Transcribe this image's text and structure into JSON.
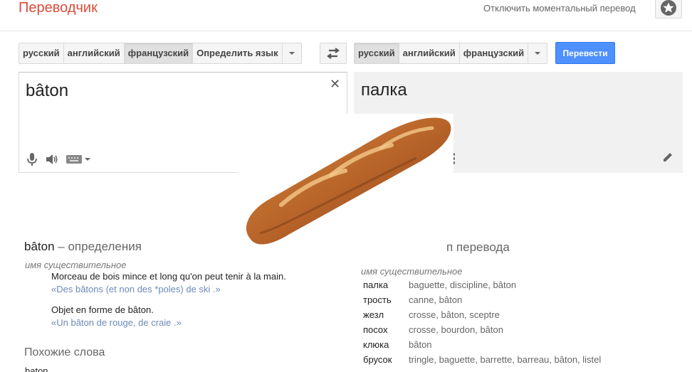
{
  "header": {
    "title": "Переводчик",
    "instant_toggle": "Отключить моментальный перевод"
  },
  "source_langs": {
    "items": [
      "русский",
      "английский",
      "французский",
      "Определить язык"
    ],
    "active_index": 2
  },
  "target_langs": {
    "items": [
      "русский",
      "английский",
      "французский"
    ],
    "active_index": 0
  },
  "translate_button": "Перевести",
  "source": {
    "text": "bâton"
  },
  "result": {
    "text": "палка"
  },
  "definitions": {
    "word": "bâton",
    "heading_rest": " – определения",
    "part_of_speech": "имя существительное",
    "entries": [
      {
        "definition": "Morceau de bois mince et long qu'on peut tenir à la main.",
        "example": "«Des bâtons (et non des *poles) de ski .»"
      },
      {
        "definition": "Objet en forme de bâton.",
        "example": "«Un bâton de rouge, de craie .»"
      }
    ],
    "similar_heading": "Похожие слова",
    "similar_word": "baton"
  },
  "translations": {
    "heading_visible": "п перевода",
    "part_of_speech": "имя существительное",
    "rows": [
      {
        "word": "палка",
        "synonyms": "baguette, discipline, bâton"
      },
      {
        "word": "трость",
        "synonyms": "canne, bâton"
      },
      {
        "word": "жезл",
        "synonyms": "crosse, bâton, sceptre"
      },
      {
        "word": "посох",
        "synonyms": "crosse, bourdon, bâton"
      },
      {
        "word": "клюка",
        "synonyms": "bâton"
      },
      {
        "word": "брусок",
        "synonyms": "tringle, baguette, barrette, barreau, bâton, listel"
      }
    ]
  },
  "colors": {
    "brand": "#dd4b39",
    "primary_button": "#4d90fe",
    "example_text": "#6b8ab8"
  },
  "icons": [
    "star-icon",
    "swap-icon",
    "clear-icon",
    "microphone-icon",
    "speaker-icon",
    "keyboard-icon",
    "more-icon",
    "pencil-icon"
  ]
}
